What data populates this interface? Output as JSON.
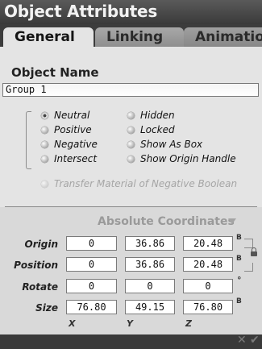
{
  "window": {
    "title": "Object Attributes"
  },
  "tabs": [
    {
      "label": "General"
    },
    {
      "label": "Linking"
    },
    {
      "label": "Animation"
    }
  ],
  "object_name": {
    "label": "Object Name",
    "value": "Group 1"
  },
  "boolean_mode": {
    "options": [
      "Neutral",
      "Positive",
      "Negative",
      "Intersect"
    ],
    "selected": "Neutral"
  },
  "display_options": [
    "Hidden",
    "Locked",
    "Show As Box",
    "Show Origin Handle"
  ],
  "transfer_option": {
    "label": "Transfer Material of Negative Boolean",
    "enabled": false
  },
  "coords": {
    "title": "Absolute Coordinates",
    "rows": [
      {
        "label": "Origin",
        "x": "0",
        "y": "36.86",
        "z": "20.48",
        "unit": "B"
      },
      {
        "label": "Position",
        "x": "0",
        "y": "36.86",
        "z": "20.48",
        "unit": "B"
      },
      {
        "label": "Rotate",
        "x": "0",
        "y": "0",
        "z": "0",
        "unit": "°"
      },
      {
        "label": "Size",
        "x": "76.80",
        "y": "49.15",
        "z": "76.80",
        "unit": "B"
      }
    ],
    "axes": [
      "X",
      "Y",
      "Z"
    ]
  },
  "footer": {
    "cancel_icon": "✕",
    "ok_icon": "✔"
  }
}
